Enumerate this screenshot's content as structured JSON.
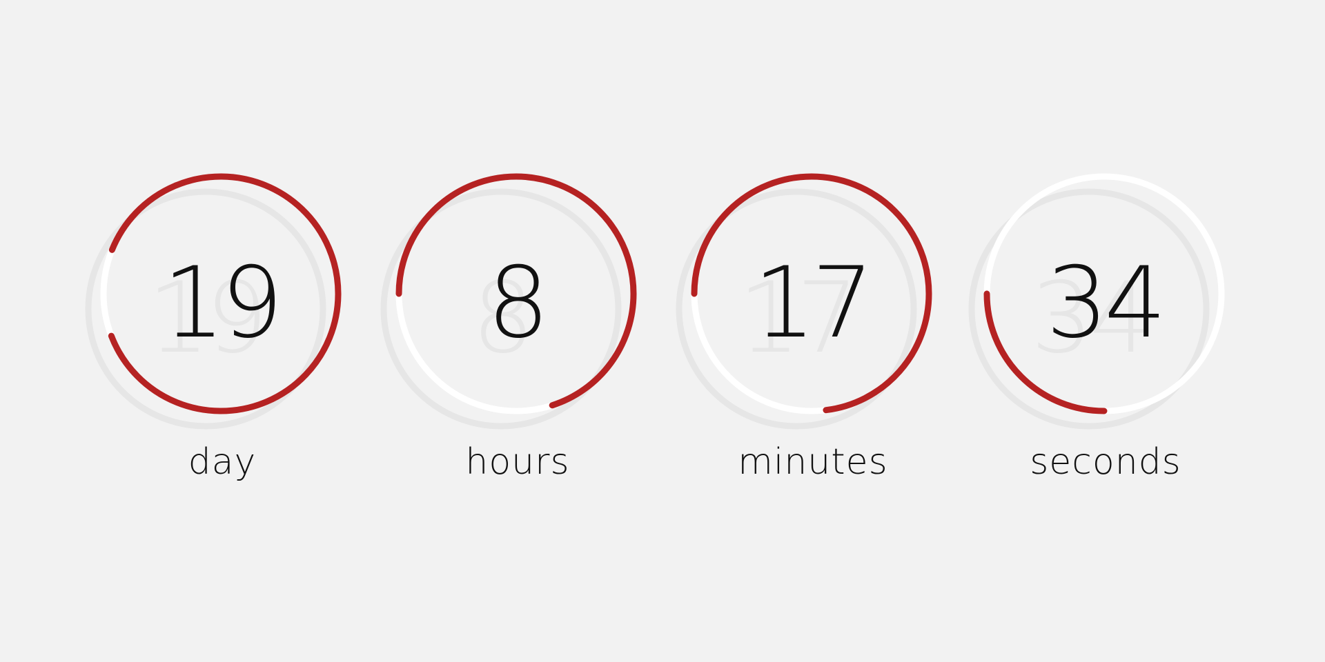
{
  "colors": {
    "background": "#f2f2f2",
    "progress": "#b52222",
    "track": "#ffffff",
    "shadow": "#e6e6e6",
    "text": "#111111"
  },
  "units": [
    {
      "key": "day",
      "value": "19",
      "label": "day",
      "progress_fraction": 0.88
    },
    {
      "key": "hours",
      "value": "8",
      "label": "hours",
      "progress_fraction": 0.7
    },
    {
      "key": "minutes",
      "value": "17",
      "label": "minutes",
      "progress_fraction": 0.73
    },
    {
      "key": "seconds",
      "value": "34",
      "label": "seconds",
      "progress_fraction": 0.25
    }
  ]
}
